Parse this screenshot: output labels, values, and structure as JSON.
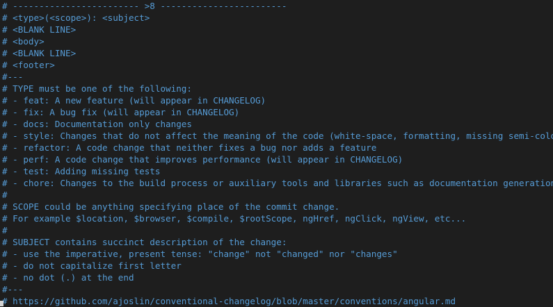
{
  "editor": {
    "lines": [
      "# ------------------------ >8 ------------------------",
      "# <type>(<scope>): <subject>",
      "# <BLANK LINE>",
      "# <body>",
      "# <BLANK LINE>",
      "# <footer>",
      "#---",
      "# TYPE must be one of the following:",
      "# - feat: A new feature (will appear in CHANGELOG)",
      "# - fix: A bug fix (will appear in CHANGELOG)",
      "# - docs: Documentation only changes",
      "# - style: Changes that do not affect the meaning of the code (white-space, formatting, missing semi-colons, etc)",
      "# - refactor: A code change that neither fixes a bug nor adds a feature",
      "# - perf: A code change that improves performance (will appear in CHANGELOG)",
      "# - test: Adding missing tests",
      "# - chore: Changes to the build process or auxiliary tools and libraries such as documentation generation",
      "#",
      "# SCOPE could be anything specifying place of the commit change.",
      "# For example $location, $browser, $compile, $rootScope, ngHref, ngClick, ngView, etc...",
      "#",
      "# SUBJECT contains succinct description of the change:",
      "# - use the imperative, present tense: \"change\" not \"changed\" nor \"changes\"",
      "# - do not capitalize first letter",
      "# - no dot (.) at the end",
      "#---",
      "# https://github.com/ajoslin/conventional-changelog/blob/master/conventions/angular.md"
    ],
    "text_color": "#569cd6",
    "background_color": "#1e1e1e"
  }
}
